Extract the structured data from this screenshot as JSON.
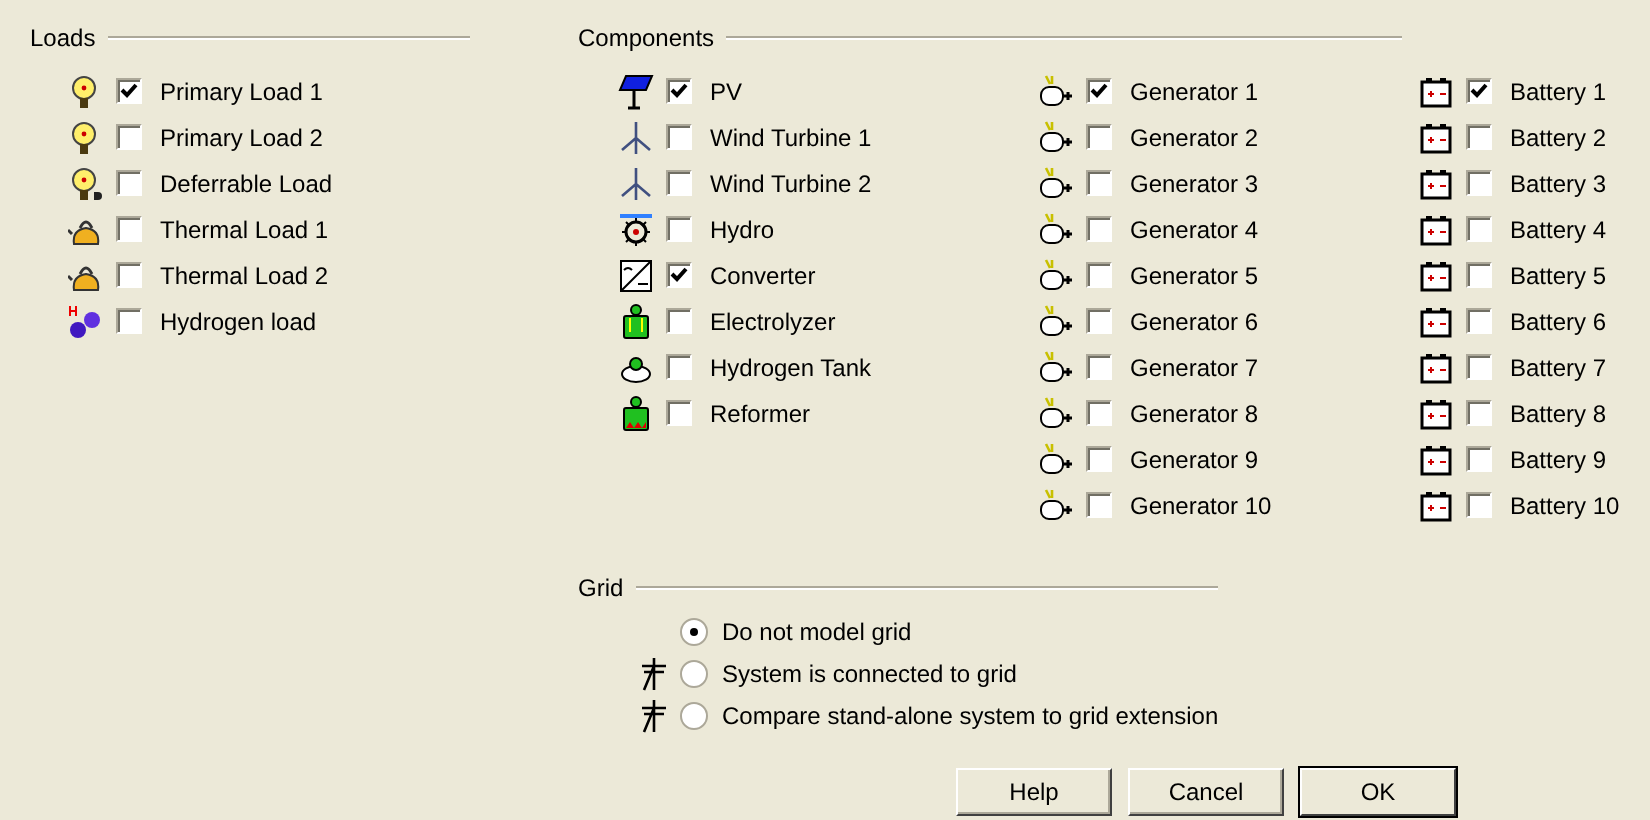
{
  "loads": {
    "title": "Loads",
    "items": [
      {
        "label": "Primary Load 1",
        "checked": true
      },
      {
        "label": "Primary Load 2",
        "checked": false
      },
      {
        "label": "Deferrable Load",
        "checked": false
      },
      {
        "label": "Thermal Load 1",
        "checked": false
      },
      {
        "label": "Thermal Load 2",
        "checked": false
      },
      {
        "label": "Hydrogen load",
        "checked": false
      }
    ]
  },
  "components": {
    "title": "Components",
    "columns": [
      {
        "kind": "misc",
        "items": [
          {
            "label": "PV",
            "checked": true
          },
          {
            "label": "Wind Turbine 1",
            "checked": false
          },
          {
            "label": "Wind Turbine 2",
            "checked": false
          },
          {
            "label": "Hydro",
            "checked": false
          },
          {
            "label": "Converter",
            "checked": true
          },
          {
            "label": "Electrolyzer",
            "checked": false
          },
          {
            "label": "Hydrogen Tank",
            "checked": false
          },
          {
            "label": "Reformer",
            "checked": false
          }
        ]
      },
      {
        "kind": "generator",
        "items": [
          {
            "label": "Generator 1",
            "checked": true
          },
          {
            "label": "Generator 2",
            "checked": false
          },
          {
            "label": "Generator 3",
            "checked": false
          },
          {
            "label": "Generator 4",
            "checked": false
          },
          {
            "label": "Generator 5",
            "checked": false
          },
          {
            "label": "Generator 6",
            "checked": false
          },
          {
            "label": "Generator 7",
            "checked": false
          },
          {
            "label": "Generator 8",
            "checked": false
          },
          {
            "label": "Generator 9",
            "checked": false
          },
          {
            "label": "Generator 10",
            "checked": false
          }
        ]
      },
      {
        "kind": "battery",
        "items": [
          {
            "label": "Battery 1",
            "checked": true
          },
          {
            "label": "Battery 2",
            "checked": false
          },
          {
            "label": "Battery 3",
            "checked": false
          },
          {
            "label": "Battery 4",
            "checked": false
          },
          {
            "label": "Battery 5",
            "checked": false
          },
          {
            "label": "Battery 6",
            "checked": false
          },
          {
            "label": "Battery 7",
            "checked": false
          },
          {
            "label": "Battery 8",
            "checked": false
          },
          {
            "label": "Battery 9",
            "checked": false
          },
          {
            "label": "Battery 10",
            "checked": false
          }
        ]
      }
    ]
  },
  "grid": {
    "title": "Grid",
    "options": [
      {
        "label": "Do not model grid",
        "selected": true
      },
      {
        "label": "System is connected to grid",
        "selected": false
      },
      {
        "label": "Compare stand-alone system to grid extension",
        "selected": false
      }
    ]
  },
  "buttons": [
    {
      "label": "Help",
      "default": false
    },
    {
      "label": "Cancel",
      "default": false
    },
    {
      "label": "OK",
      "default": true
    }
  ]
}
